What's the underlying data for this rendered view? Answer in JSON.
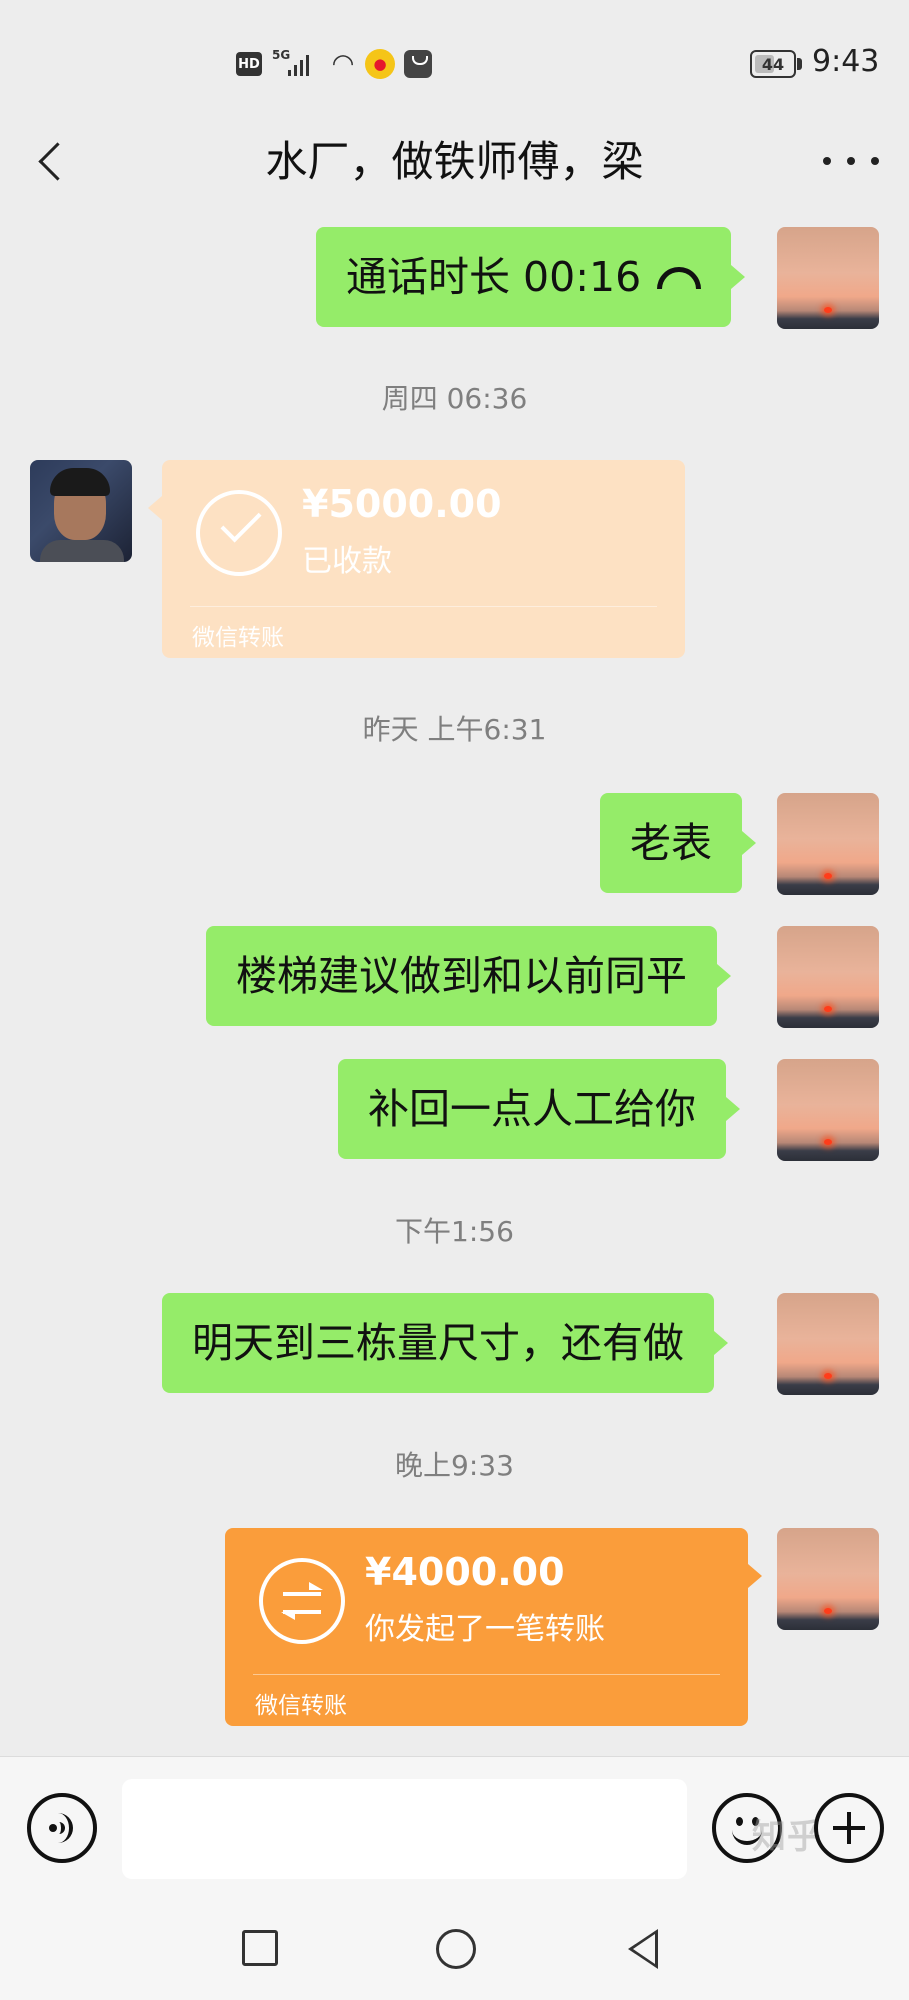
{
  "status_bar": {
    "hd": "HD",
    "network": "5G",
    "battery_level": "44",
    "time": "9:43"
  },
  "header": {
    "title": "水厂，做铁师傅，梁",
    "back_icon": "chevron-left-icon",
    "more_icon": "more-dots-icon"
  },
  "messages": {
    "call": {
      "text": "通话时长 00:16",
      "icon": "phone-hangup-icon"
    },
    "ts1": "周四 06:36",
    "received_transfer": {
      "amount": "¥5000.00",
      "status": "已收款",
      "footer": "微信转账",
      "color": "#fde1c3"
    },
    "ts2": "昨天 上午6:31",
    "m1": "老表",
    "m2": "楼梯建议做到和以前同平",
    "m3": "补回一点人工给你",
    "ts3": "下午1:56",
    "m4": "明天到三栋量尺寸，还有做",
    "ts4": "晚上9:33",
    "sent_transfer": {
      "amount": "¥4000.00",
      "status": "你发起了一笔转账",
      "footer": "微信转账",
      "color": "#fa9d3b"
    }
  },
  "input_bar": {
    "input_value": "",
    "voice_icon": "voice-icon",
    "emoji_icon": "emoji-icon",
    "plus_icon": "plus-icon",
    "watermark": "知乎"
  },
  "colors": {
    "bubble_green": "#95ec69",
    "background": "#ededed"
  }
}
